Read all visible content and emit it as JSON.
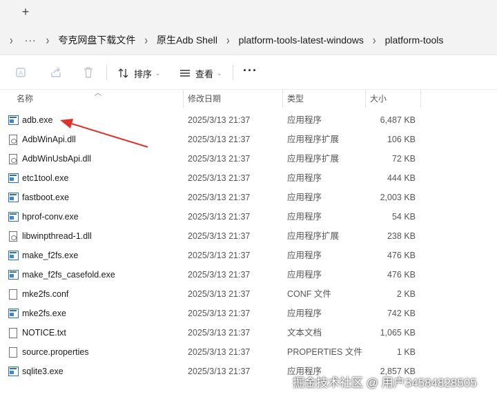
{
  "tabbar": {
    "new_tab_glyph": "+"
  },
  "address": {
    "ellipsis": "···",
    "crumbs": [
      "夸克网盘下载文件",
      "原生Adb Shell",
      "platform-tools-latest-windows",
      "platform-tools"
    ]
  },
  "toolbar": {
    "sort_label": "排序",
    "view_label": "查看",
    "more_glyph": "···"
  },
  "columns": {
    "name": "名称",
    "date": "修改日期",
    "type": "类型",
    "size": "大小"
  },
  "files": [
    {
      "name": "adb.exe",
      "date": "2025/3/13 21:37",
      "type": "应用程序",
      "size": "6,487 KB",
      "icon": "exe-icon"
    },
    {
      "name": "AdbWinApi.dll",
      "date": "2025/3/13 21:37",
      "type": "应用程序扩展",
      "size": "106 KB",
      "icon": "dll-icon"
    },
    {
      "name": "AdbWinUsbApi.dll",
      "date": "2025/3/13 21:37",
      "type": "应用程序扩展",
      "size": "72 KB",
      "icon": "dll-icon"
    },
    {
      "name": "etc1tool.exe",
      "date": "2025/3/13 21:37",
      "type": "应用程序",
      "size": "444 KB",
      "icon": "exe-icon"
    },
    {
      "name": "fastboot.exe",
      "date": "2025/3/13 21:37",
      "type": "应用程序",
      "size": "2,003 KB",
      "icon": "exe-icon"
    },
    {
      "name": "hprof-conv.exe",
      "date": "2025/3/13 21:37",
      "type": "应用程序",
      "size": "54 KB",
      "icon": "exe-icon"
    },
    {
      "name": "libwinpthread-1.dll",
      "date": "2025/3/13 21:37",
      "type": "应用程序扩展",
      "size": "238 KB",
      "icon": "dll-icon"
    },
    {
      "name": "make_f2fs.exe",
      "date": "2025/3/13 21:37",
      "type": "应用程序",
      "size": "476 KB",
      "icon": "exe-icon"
    },
    {
      "name": "make_f2fs_casefold.exe",
      "date": "2025/3/13 21:37",
      "type": "应用程序",
      "size": "476 KB",
      "icon": "exe-icon"
    },
    {
      "name": "mke2fs.conf",
      "date": "2025/3/13 21:37",
      "type": "CONF 文件",
      "size": "2 KB",
      "icon": "file-icon"
    },
    {
      "name": "mke2fs.exe",
      "date": "2025/3/13 21:37",
      "type": "应用程序",
      "size": "742 KB",
      "icon": "exe-icon"
    },
    {
      "name": "NOTICE.txt",
      "date": "2025/3/13 21:37",
      "type": "文本文档",
      "size": "1,065 KB",
      "icon": "file-icon"
    },
    {
      "name": "source.properties",
      "date": "2025/3/13 21:37",
      "type": "PROPERTIES 文件",
      "size": "1 KB",
      "icon": "file-icon"
    },
    {
      "name": "sqlite3.exe",
      "date": "2025/3/13 21:37",
      "type": "应用程序",
      "size": "2,857 KB",
      "icon": "exe-icon"
    }
  ],
  "annotation": {
    "arrow_color": "#e0302a"
  },
  "watermark": "掘金技术社区 @ 用户34584828505"
}
